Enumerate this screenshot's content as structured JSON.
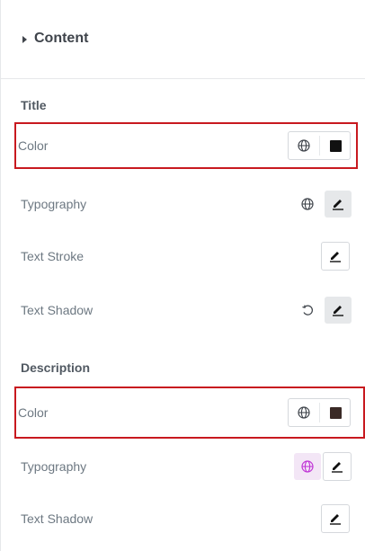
{
  "content": {
    "title": "Content"
  },
  "sections": {
    "title": {
      "heading": "Title",
      "rows": {
        "color": {
          "label": "Color"
        },
        "typography": {
          "label": "Typography"
        },
        "text_stroke": {
          "label": "Text Stroke"
        },
        "text_shadow": {
          "label": "Text Shadow"
        }
      }
    },
    "description": {
      "heading": "Description",
      "rows": {
        "color": {
          "label": "Color"
        },
        "typography": {
          "label": "Typography"
        },
        "text_shadow": {
          "label": "Text Shadow"
        }
      }
    }
  },
  "colors": {
    "highlight": "#c8191f",
    "title_color_swatch": "#111111",
    "description_color_swatch": "#3a2a26",
    "global_active": "#c036d6"
  },
  "icons": {
    "caret": "caret-right-icon",
    "global": "globe-icon",
    "edit": "pencil-icon",
    "reset": "reset-icon"
  }
}
